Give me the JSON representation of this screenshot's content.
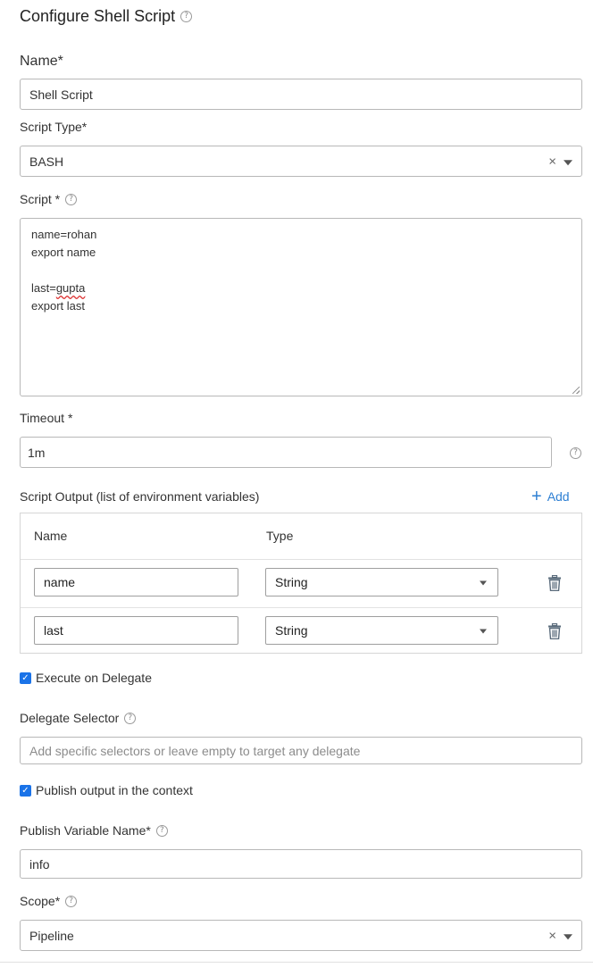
{
  "header": {
    "title": "Configure Shell Script",
    "help": "?"
  },
  "name_field": {
    "label": "Name*",
    "value": "Shell Script"
  },
  "script_type": {
    "label": "Script Type*",
    "value": "BASH",
    "clear": "×"
  },
  "script": {
    "label": "Script *",
    "lines": [
      "name=rohan",
      "export name",
      "",
      "last=gupta",
      "export last"
    ],
    "misspelled_word": "gupta"
  },
  "timeout": {
    "label": "Timeout *",
    "value": "1m"
  },
  "script_output": {
    "label": "Script Output (list of environment variables)",
    "add_label": "Add",
    "columns": [
      "Name",
      "Type"
    ],
    "rows": [
      {
        "name": "name",
        "type": "String"
      },
      {
        "name": "last",
        "type": "String"
      }
    ]
  },
  "execute_on_delegate": {
    "label": "Execute on Delegate",
    "checked": true
  },
  "delegate_selector": {
    "label": "Delegate Selector",
    "placeholder": "Add specific selectors or leave empty to target any delegate"
  },
  "publish_output": {
    "label": "Publish output in the context",
    "checked": true
  },
  "publish_variable": {
    "label": "Publish Variable Name*",
    "value": "info"
  },
  "scope": {
    "label": "Scope*",
    "value": "Pipeline",
    "clear": "×"
  },
  "icons": [
    "help-icon",
    "clear-icon",
    "chevron-down-icon",
    "plus-icon",
    "trash-icon",
    "checkbox-checked-icon"
  ],
  "colors": {
    "accent": "#1a73e8",
    "link": "#2d7fd3",
    "border": "#b8b8b8"
  }
}
